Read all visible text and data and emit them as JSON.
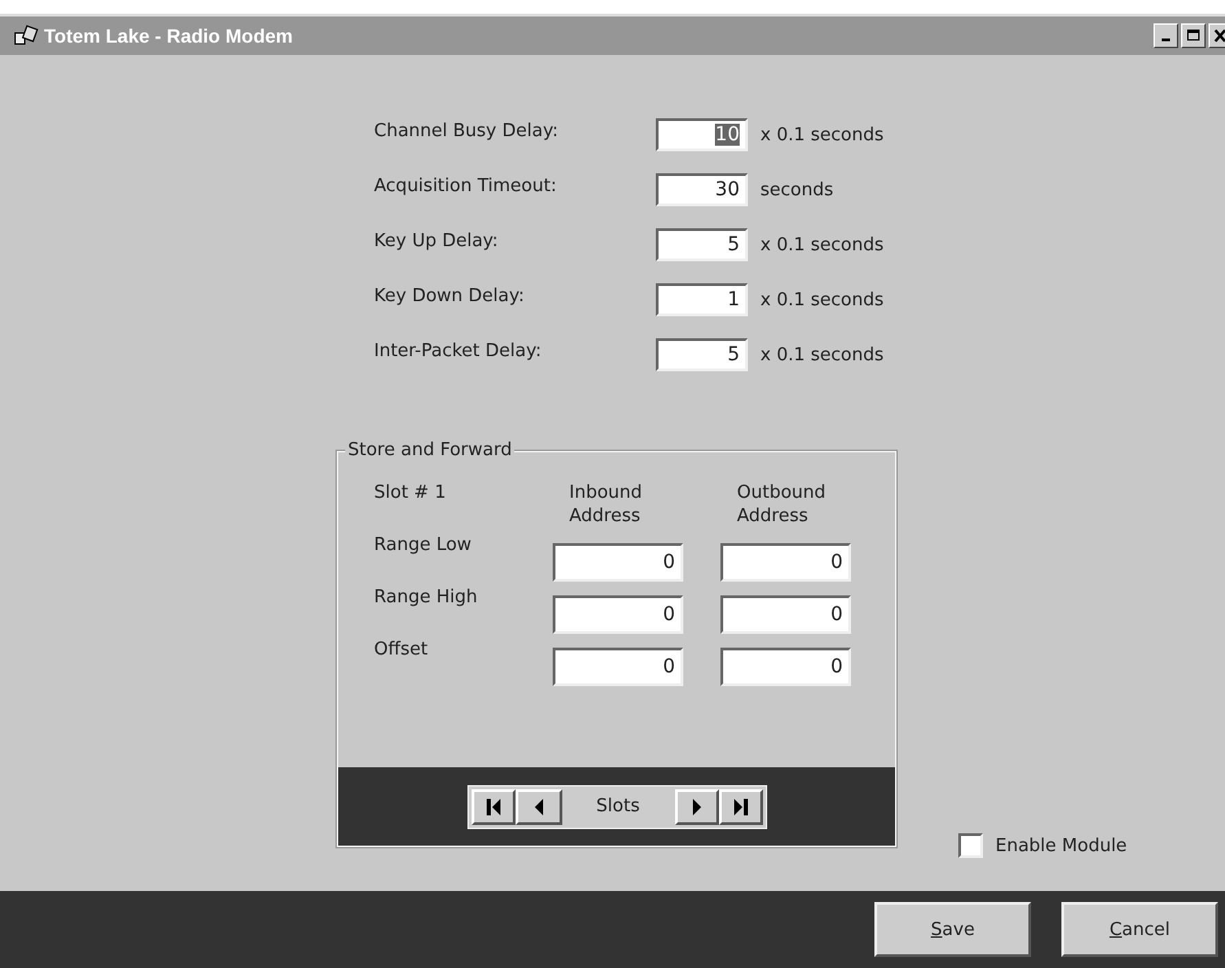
{
  "window": {
    "title": "Totem Lake - Radio Modem"
  },
  "settings": [
    {
      "label": "Channel Busy Delay:",
      "value": "10",
      "unit": "x 0.1 seconds",
      "text_selected": true
    },
    {
      "label": "Acquisition Timeout:",
      "value": "30",
      "unit": "seconds",
      "text_selected": false
    },
    {
      "label": "Key Up Delay:",
      "value": "5",
      "unit": "x 0.1 seconds",
      "text_selected": false
    },
    {
      "label": "Key Down Delay:",
      "value": "1",
      "unit": "x 0.1 seconds",
      "text_selected": false
    },
    {
      "label": "Inter-Packet Delay:",
      "value": "5",
      "unit": "x 0.1 seconds",
      "text_selected": false
    }
  ],
  "store_and_forward": {
    "title": "Store and Forward",
    "slot": "Slot # 1",
    "columns": [
      "Inbound Address",
      "Outbound Address"
    ],
    "rows": [
      {
        "label": "Range Low",
        "values": [
          "0",
          "0"
        ]
      },
      {
        "label": "Range High",
        "values": [
          "0",
          "0"
        ]
      },
      {
        "label": "Offset",
        "values": [
          "0",
          "0"
        ]
      }
    ],
    "navigator": {
      "label": "Slots"
    }
  },
  "enable_module": {
    "label": "Enable Module",
    "checked": false
  },
  "buttons": [
    {
      "label": "Save"
    },
    {
      "label": "Cancel"
    }
  ]
}
